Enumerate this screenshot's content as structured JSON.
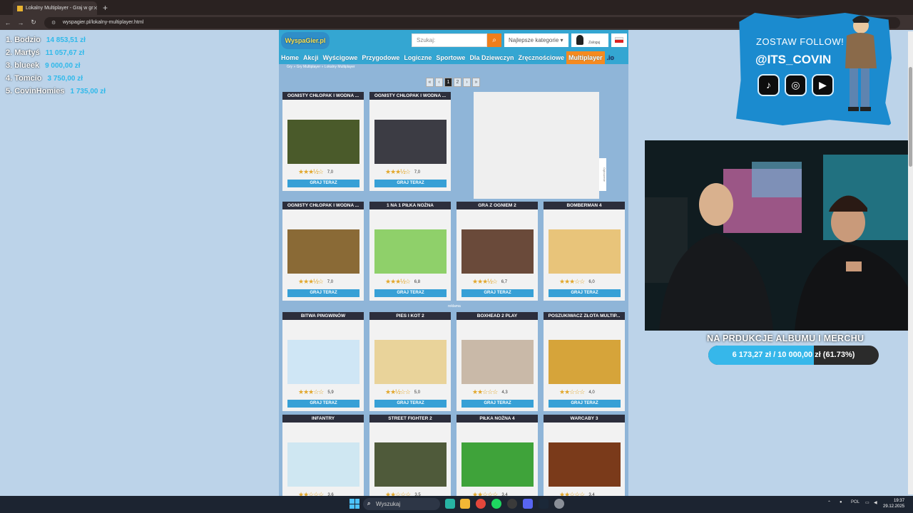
{
  "browser": {
    "tab_title": "Lokalny Multiplayer - Graj w gr",
    "url": "wyspagier.pl/lokalny-multiplayer.html"
  },
  "leaderboard": [
    {
      "name": "1. Bodzio",
      "amount": "14 853,51 zł"
    },
    {
      "name": "2. Martyś",
      "amount": "11 057,67 zł"
    },
    {
      "name": "3. blueek",
      "amount": "9 000,00 zł"
    },
    {
      "name": "4. Tomcio",
      "amount": "3 750,00 zł"
    },
    {
      "name": "5. CovinHomies",
      "amount": "1 735,00 zł"
    }
  ],
  "site": {
    "logo": "WyspaGier.pl",
    "search_placeholder": "Szukaj:",
    "category_select": "Najlepsze kategorie",
    "login_label": "Zaloguj",
    "menu": [
      "Home",
      "Akcji",
      "Wyścigowe",
      "Przygodowe",
      "Logiczne",
      "Sportowe",
      "Dla Dziewczyn",
      "Zręcznościowe",
      "Multiplayer",
      ".io"
    ],
    "breadcrumb": "Gry » Gry Multiplayer » Lokalny Multiplayer",
    "pagination": [
      "«",
      "‹",
      "1",
      "2",
      "›",
      "»"
    ],
    "ad_label": "Ogłoszenie",
    "reklama": "reklama",
    "play_label": "GRAJ TERAZ"
  },
  "games": [
    {
      "title": "OGNISTY CHŁOPAK I WODNA ...",
      "rating": "7,0",
      "stars": "★★★½☆",
      "thumb": "#4a5a2a"
    },
    {
      "title": "OGNISTY CHŁOPAK I WODNA ...",
      "rating": "7,0",
      "stars": "★★★½☆",
      "thumb": "#3c3c44"
    },
    {
      "title": "OGNISTY CHŁOPAK I WODNA ...",
      "rating": "7,0",
      "stars": "★★★½☆",
      "thumb": "#8a6a36"
    },
    {
      "title": "1 NA 1 PIŁKA NOŻNA",
      "rating": "6,8",
      "stars": "★★★½☆",
      "thumb": "#8fd06a"
    },
    {
      "title": "GRA Z OGNIEM 2",
      "rating": "6,7",
      "stars": "★★★½☆",
      "thumb": "#6a4a3a"
    },
    {
      "title": "BOMBERMAN 4",
      "rating": "6,0",
      "stars": "★★★☆☆",
      "thumb": "#e8c47a"
    },
    {
      "title": "BITWA PINGWINÓW",
      "rating": "5,9",
      "stars": "★★★☆☆",
      "thumb": "#cfe6f5"
    },
    {
      "title": "PIES I KOT 2",
      "rating": "5,0",
      "stars": "★★½☆☆",
      "thumb": "#e9d39a"
    },
    {
      "title": "BOXHEAD 2 PLAY",
      "rating": "4,3",
      "stars": "★★☆☆☆",
      "thumb": "#c9b9a8"
    },
    {
      "title": "POSZUKIWACZ ZŁOTA MULTIP...",
      "rating": "4,0",
      "stars": "★★☆☆☆",
      "thumb": "#d6a43a"
    },
    {
      "title": "INFANTRY",
      "rating": "3,6",
      "stars": "★★☆☆☆",
      "thumb": "#cfe7f2"
    },
    {
      "title": "STREET FIGHTER 2",
      "rating": "3,5",
      "stars": "★★☆☆☆",
      "thumb": "#4f5a3a"
    },
    {
      "title": "PIŁKA NOŻNA 4",
      "rating": "3,4",
      "stars": "★★☆☆☆",
      "thumb": "#3fa33a"
    },
    {
      "title": "WARCABY 3",
      "rating": "3,4",
      "stars": "★★☆☆☆",
      "thumb": "#7a3a1a"
    }
  ],
  "overlay": {
    "follow_heading": "ZOSTAW FOLLOW!",
    "handle": "@ITS_COVIN",
    "goal_text": "NA PRDUKCJE ALBUMU I MERCHU",
    "goal_label": "6 173,27 zł / 10 000,00 zł (61.73%)",
    "goal_progress": 0.6173
  },
  "taskbar": {
    "search": "Wyszukaj",
    "lang": "POL",
    "time": "19:37",
    "date": "29.12.2025"
  }
}
